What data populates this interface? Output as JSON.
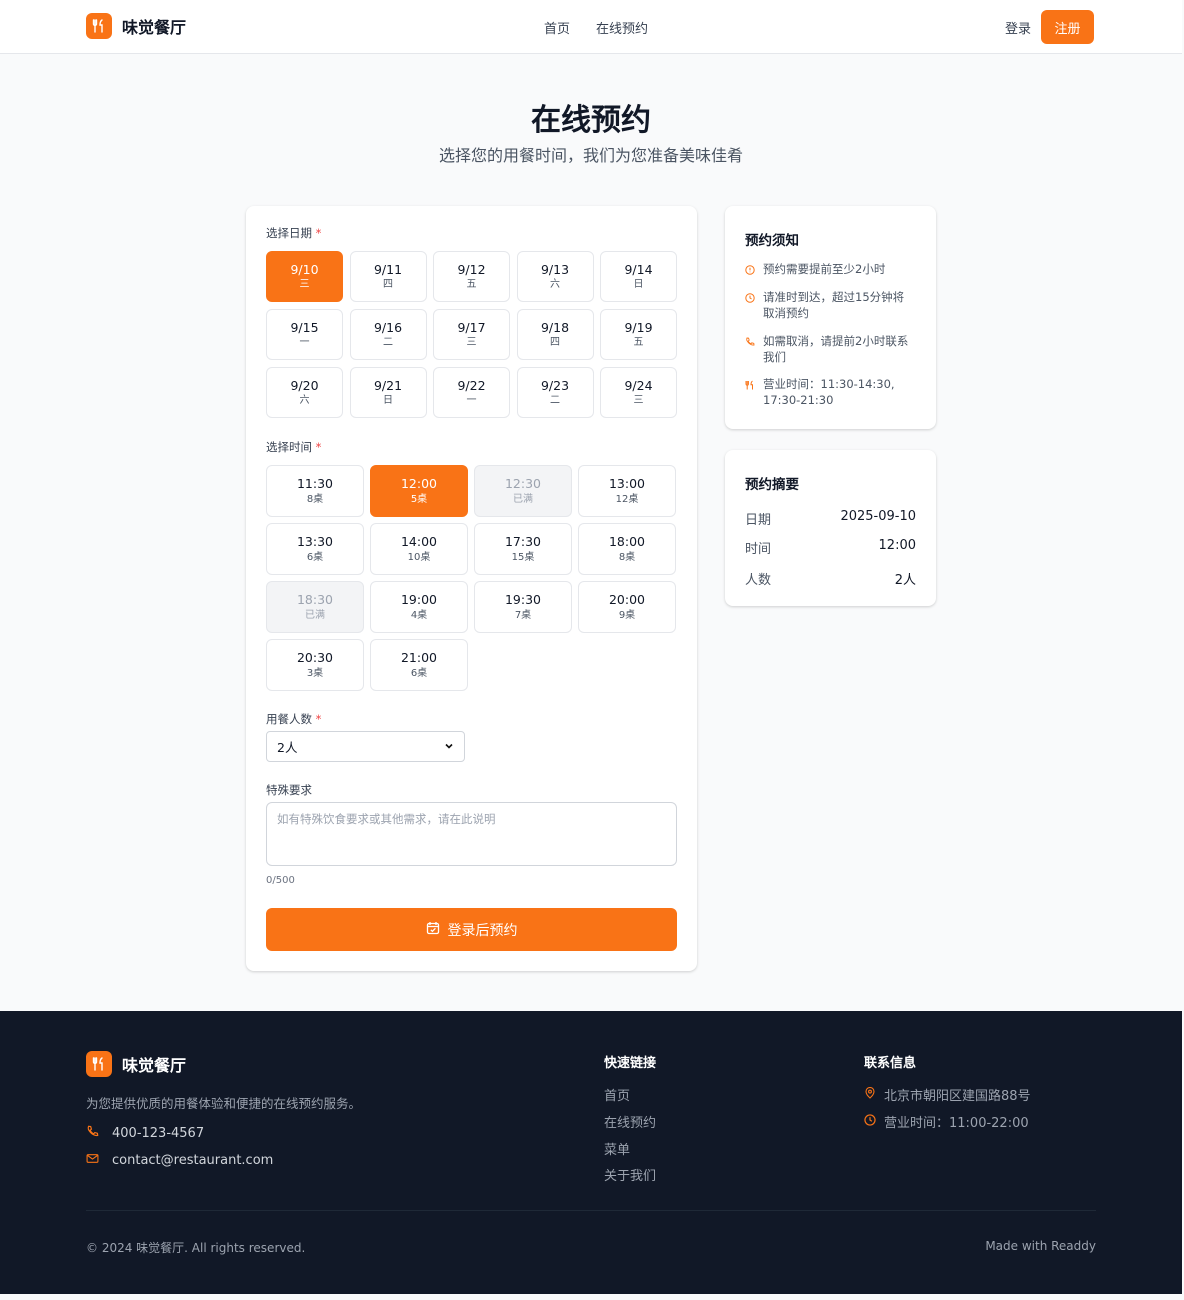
{
  "brand": {
    "name": "味觉餐厅"
  },
  "nav": {
    "items": [
      "首页",
      "在线预约"
    ],
    "login": "登录",
    "register": "注册"
  },
  "hero": {
    "title": "在线预约",
    "subtitle": "选择您的用餐时间，我们为您准备美味佳肴"
  },
  "form": {
    "date_label": "选择日期",
    "dates": [
      {
        "d": "9/10",
        "w": "三",
        "state": "selected"
      },
      {
        "d": "9/11",
        "w": "四",
        "state": "normal"
      },
      {
        "d": "9/12",
        "w": "五",
        "state": "normal"
      },
      {
        "d": "9/13",
        "w": "六",
        "state": "normal"
      },
      {
        "d": "9/14",
        "w": "日",
        "state": "normal"
      },
      {
        "d": "9/15",
        "w": "一",
        "state": "normal"
      },
      {
        "d": "9/16",
        "w": "二",
        "state": "normal"
      },
      {
        "d": "9/17",
        "w": "三",
        "state": "normal"
      },
      {
        "d": "9/18",
        "w": "四",
        "state": "normal"
      },
      {
        "d": "9/19",
        "w": "五",
        "state": "normal"
      },
      {
        "d": "9/20",
        "w": "六",
        "state": "normal"
      },
      {
        "d": "9/21",
        "w": "日",
        "state": "normal"
      },
      {
        "d": "9/22",
        "w": "一",
        "state": "normal"
      },
      {
        "d": "9/23",
        "w": "二",
        "state": "normal"
      },
      {
        "d": "9/24",
        "w": "三",
        "state": "normal"
      }
    ],
    "time_label": "选择时间",
    "times": [
      {
        "t": "11:30",
        "s": "8桌",
        "state": "normal"
      },
      {
        "t": "12:00",
        "s": "5桌",
        "state": "selected"
      },
      {
        "t": "12:30",
        "s": "已满",
        "state": "full"
      },
      {
        "t": "13:00",
        "s": "12桌",
        "state": "normal"
      },
      {
        "t": "13:30",
        "s": "6桌",
        "state": "normal"
      },
      {
        "t": "14:00",
        "s": "10桌",
        "state": "normal"
      },
      {
        "t": "17:30",
        "s": "15桌",
        "state": "normal"
      },
      {
        "t": "18:00",
        "s": "8桌",
        "state": "normal"
      },
      {
        "t": "18:30",
        "s": "已满",
        "state": "full"
      },
      {
        "t": "19:00",
        "s": "4桌",
        "state": "normal"
      },
      {
        "t": "19:30",
        "s": "7桌",
        "state": "normal"
      },
      {
        "t": "20:00",
        "s": "9桌",
        "state": "normal"
      },
      {
        "t": "20:30",
        "s": "3桌",
        "state": "normal"
      },
      {
        "t": "21:00",
        "s": "6桌",
        "state": "normal"
      }
    ],
    "guests_label": "用餐人数",
    "guests_value": "2人",
    "req_mark": "*",
    "special_label": "特殊要求",
    "special_placeholder": "如有特殊饮食要求或其他需求，请在此说明",
    "char_count": "0/500",
    "submit": "登录后预约"
  },
  "notice": {
    "title": "预约须知",
    "items": [
      {
        "icon": "info-icon",
        "text": "预约需要提前至少2小时"
      },
      {
        "icon": "clock-icon",
        "text": "请准时到达，超过15分钟将取消预约"
      },
      {
        "icon": "phone-icon",
        "text": "如需取消，请提前2小时联系我们"
      },
      {
        "icon": "utensils-icon",
        "text": "营业时间：11:30-14:30, 17:30-21:30"
      }
    ]
  },
  "summary": {
    "title": "预约摘要",
    "rows": [
      {
        "k": "日期",
        "v": "2025-09-10"
      },
      {
        "k": "时间",
        "v": "12:00"
      },
      {
        "k": "人数",
        "v": "2人"
      }
    ]
  },
  "footer": {
    "name": "味觉餐厅",
    "desc": "为您提供优质的用餐体验和便捷的在线预约服务。",
    "phone": "400-123-4567",
    "email": "contact@restaurant.com",
    "links_title": "快速链接",
    "links": [
      "首页",
      "在线预约",
      "菜单",
      "关于我们"
    ],
    "contact_title": "联系信息",
    "address": "北京市朝阳区建国路88号",
    "hours": "营业时间：11:00-22:00",
    "copyright": "© 2024 味觉餐厅. All rights reserved.",
    "made": "Made with Readdy"
  },
  "colors": {
    "accent": "#f97316",
    "footer_bg": "#111827"
  }
}
